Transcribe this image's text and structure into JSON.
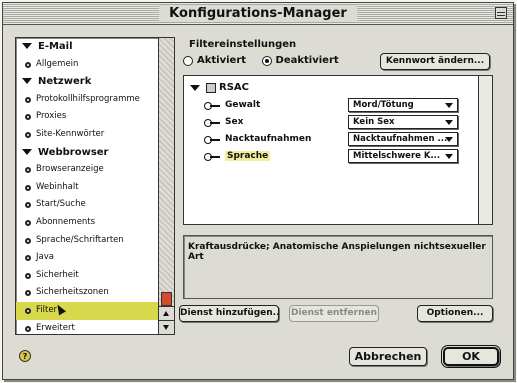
{
  "window": {
    "title": "Konfigurations-Manager"
  },
  "sidebar": {
    "items": [
      {
        "type": "group",
        "label": "E-Mail"
      },
      {
        "type": "item",
        "label": "Allgemein"
      },
      {
        "type": "group",
        "label": "Netzwerk"
      },
      {
        "type": "item",
        "label": "Protokollhilfsprogramme"
      },
      {
        "type": "item",
        "label": "Proxies"
      },
      {
        "type": "item",
        "label": "Site-Kennwörter"
      },
      {
        "type": "group",
        "label": "Webbrowser"
      },
      {
        "type": "item",
        "label": "Browseranzeige"
      },
      {
        "type": "item",
        "label": "Webinhalt"
      },
      {
        "type": "item",
        "label": "Start/Suche"
      },
      {
        "type": "item",
        "label": "Abonnements"
      },
      {
        "type": "item",
        "label": "Sprache/Schriftarten"
      },
      {
        "type": "item",
        "label": "Java"
      },
      {
        "type": "item",
        "label": "Sicherheit"
      },
      {
        "type": "item",
        "label": "Sicherheitszonen"
      },
      {
        "type": "item",
        "label": "Filter",
        "selected": true
      },
      {
        "type": "item",
        "label": "Erweitert"
      }
    ]
  },
  "main": {
    "section_title": "Filtereinstellungen",
    "radio_active": "Aktiviert",
    "radio_inactive": "Deaktiviert",
    "selected_radio": "Deaktiviert",
    "change_password_button": "Kennwort ändern...",
    "tree_root": "RSAC",
    "rows": [
      {
        "label": "Gewalt",
        "value": "Mord/Tötung"
      },
      {
        "label": "Sex",
        "value": "Kein Sex"
      },
      {
        "label": "Nacktaufnahmen",
        "value": "Nacktaufnahmen ..."
      },
      {
        "label": "Sprache",
        "value": "Mittelschwere K...",
        "highlighted": true
      }
    ],
    "description": "Kraftausdrücke; Anatomische Anspielungen nichtsexueller Art",
    "add_service_button": "Dienst hinzufügen...",
    "remove_service_button": "Dienst entfernen",
    "options_button": "Optionen..."
  },
  "footer": {
    "cancel_button": "Abbrechen",
    "ok_button": "OK"
  },
  "colors": {
    "selection": "#d8d84c",
    "scroll_thumb": "#d84a2c"
  }
}
